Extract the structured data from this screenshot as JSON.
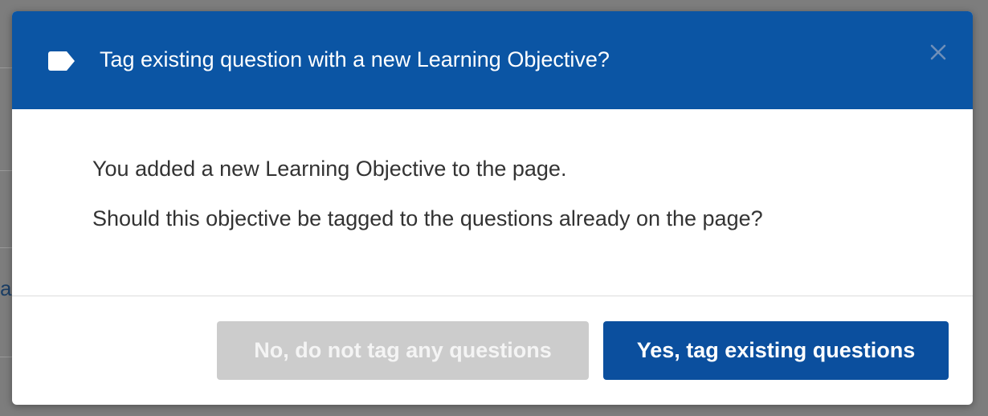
{
  "dialog": {
    "title": "Tag existing question with a new Learning Objective?",
    "close_label": "×",
    "body": {
      "line1": "You added a new Learning Objective to the page.",
      "line2": "Should this objective be tagged to the questions already on the page?"
    },
    "buttons": {
      "no_label": "No, do not tag any questions",
      "yes_label": "Yes, tag existing questions"
    }
  },
  "background": {
    "partial_text": "a"
  },
  "icons": {
    "header_icon": "tag-icon",
    "close_icon": "close-icon"
  },
  "colors": {
    "header_background": "#0b55a4",
    "primary_button": "#0b4f9e",
    "disabled_button": "#cccccc",
    "body_text": "#333333"
  }
}
